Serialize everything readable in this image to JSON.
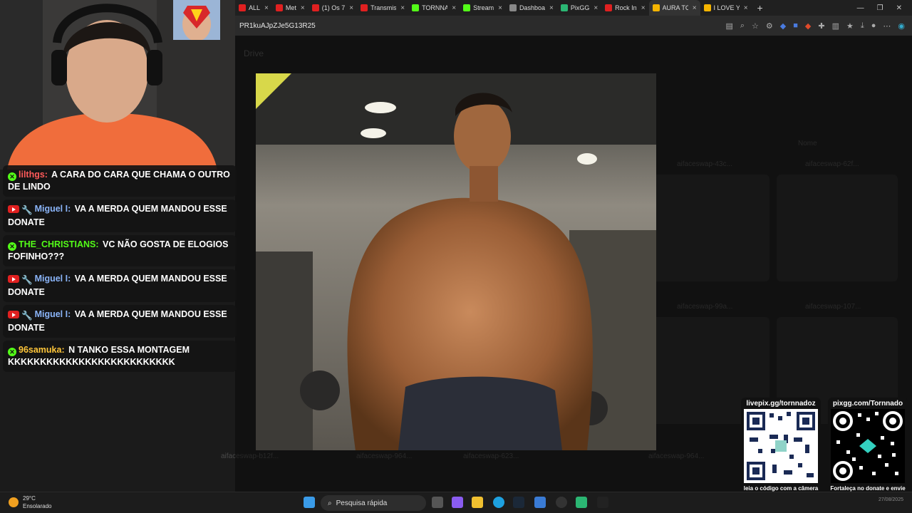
{
  "browser": {
    "tabs": [
      {
        "label": "ALL",
        "color": "#e02020"
      },
      {
        "label": "Met",
        "color": "#e02020"
      },
      {
        "label": "(1) Os 7",
        "color": "#e02020"
      },
      {
        "label": "Transmis",
        "color": "#e02020"
      },
      {
        "label": "TORNNA",
        "color": "#53fc18"
      },
      {
        "label": "Stream",
        "color": "#53fc18"
      },
      {
        "label": "Dashboa",
        "color": "#888888"
      },
      {
        "label": "PixGG",
        "color": "#2bb673"
      },
      {
        "label": "Rock In",
        "color": "#e02020"
      },
      {
        "label": "AURA TC",
        "color": "#f4b400"
      },
      {
        "label": "I LOVE Y",
        "color": "#f4b400"
      }
    ],
    "active_tab_index": 9,
    "url": "PR1kuAJpZJe5G13R25"
  },
  "drive": {
    "title": "Drive",
    "sort_label": "Nome",
    "files": [
      "aifaceswap-43c...",
      "aifaceswap-62f...",
      "aifaceswap-99a...",
      "aifaceswap-107...",
      "aifaceswap-b12f...",
      "aifaceswap-964...",
      "aifaceswap-623...",
      "aifaceswap-964..."
    ]
  },
  "chat": {
    "messages": [
      {
        "platform": "kick",
        "user": "lilthgs:",
        "user_color": "#ff5a5a",
        "text": "A CARA DO CARA QUE CHAMA O OUTRO DE LINDO"
      },
      {
        "platform": "youtube",
        "user": "Miguel I:",
        "user_color": "#8ab4f8",
        "text": "VA A MERDA QUEM MANDOU ESSE DONATE"
      },
      {
        "platform": "kick",
        "user": "THE_CHRISTIANS:",
        "user_color": "#53fc18",
        "text": "VC NÃO GOSTA DE ELOGIOS FOFINHO???"
      },
      {
        "platform": "youtube",
        "user": "Miguel I:",
        "user_color": "#8ab4f8",
        "text": "VA A MERDA QUEM MANDOU ESSE DONATE"
      },
      {
        "platform": "youtube",
        "user": "Miguel I:",
        "user_color": "#8ab4f8",
        "text": "VA A MERDA QUEM MANDOU ESSE DONATE"
      },
      {
        "platform": "kick",
        "user": "96samuka:",
        "user_color": "#ffc63a",
        "text": "N TANKO ESSA MONTAGEM KKKKKKKKKKKKKKKKKKKKKKKKKK"
      }
    ]
  },
  "qr_left": {
    "title": "livepix.gg/tornnadoz",
    "caption": "leia o código com a câmera do celular."
  },
  "qr_right": {
    "title": "pixgg.com/Tornnado",
    "caption": "Fortaleça no donate e envie sua mensagem!"
  },
  "taskbar": {
    "temperature": "29°C",
    "weather": "Ensolarado",
    "search_placeholder": "Pesquisa rápida",
    "date": "27/08/2025"
  }
}
